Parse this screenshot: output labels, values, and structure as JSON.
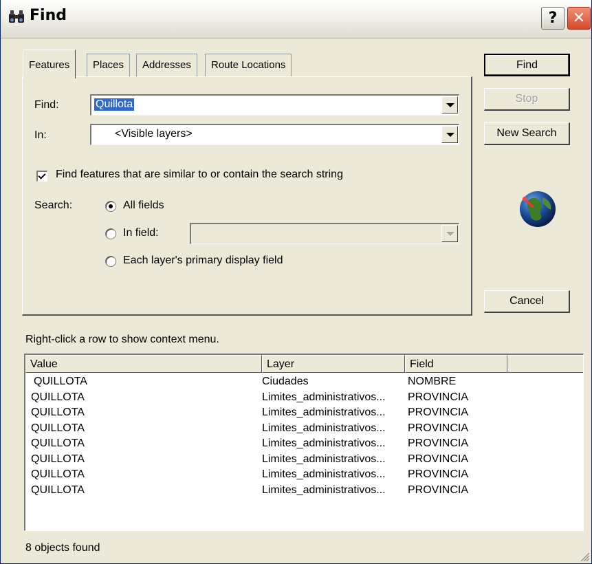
{
  "window": {
    "title": "Find",
    "help_label": "?",
    "close_label": "✕"
  },
  "tabs": [
    {
      "label": "Features",
      "active": true
    },
    {
      "label": "Places",
      "active": false
    },
    {
      "label": "Addresses",
      "active": false
    },
    {
      "label": "Route Locations",
      "active": false
    }
  ],
  "form": {
    "find_label": "Find:",
    "find_value": "Quillota",
    "in_label": "In:",
    "in_value": "<Visible layers>",
    "similar_label": "Find features that are similar to or contain the search string",
    "similar_checked": true,
    "search_label": "Search:",
    "radio_all": "All fields",
    "radio_field": "In field:",
    "radio_primary": "Each layer's primary display field",
    "selected_radio": "All fields",
    "in_field_value": ""
  },
  "buttons": {
    "find": "Find",
    "stop": "Stop",
    "new_search": "New Search",
    "cancel": "Cancel"
  },
  "hint": "Right-click a row to show context menu.",
  "results": {
    "columns": [
      "Value",
      "Layer",
      "Field"
    ],
    "rows": [
      [
        "QUILLOTA",
        "Ciudades",
        "NOMBRE"
      ],
      [
        "QUILLOTA",
        "Limites_administrativos...",
        "PROVINCIA"
      ],
      [
        "QUILLOTA",
        "Limites_administrativos...",
        "PROVINCIA"
      ],
      [
        "QUILLOTA",
        "Limites_administrativos...",
        "PROVINCIA"
      ],
      [
        "QUILLOTA",
        "Limites_administrativos...",
        "PROVINCIA"
      ],
      [
        "QUILLOTA",
        "Limites_administrativos...",
        "PROVINCIA"
      ],
      [
        "QUILLOTA",
        "Limites_administrativos...",
        "PROVINCIA"
      ],
      [
        "QUILLOTA",
        "Limites_administrativos...",
        "PROVINCIA"
      ]
    ]
  },
  "status": "8 objects found",
  "colors": {
    "dialog_bg": "#ece9d8",
    "selection": "#316ac5",
    "close_red": "#d5492b"
  }
}
